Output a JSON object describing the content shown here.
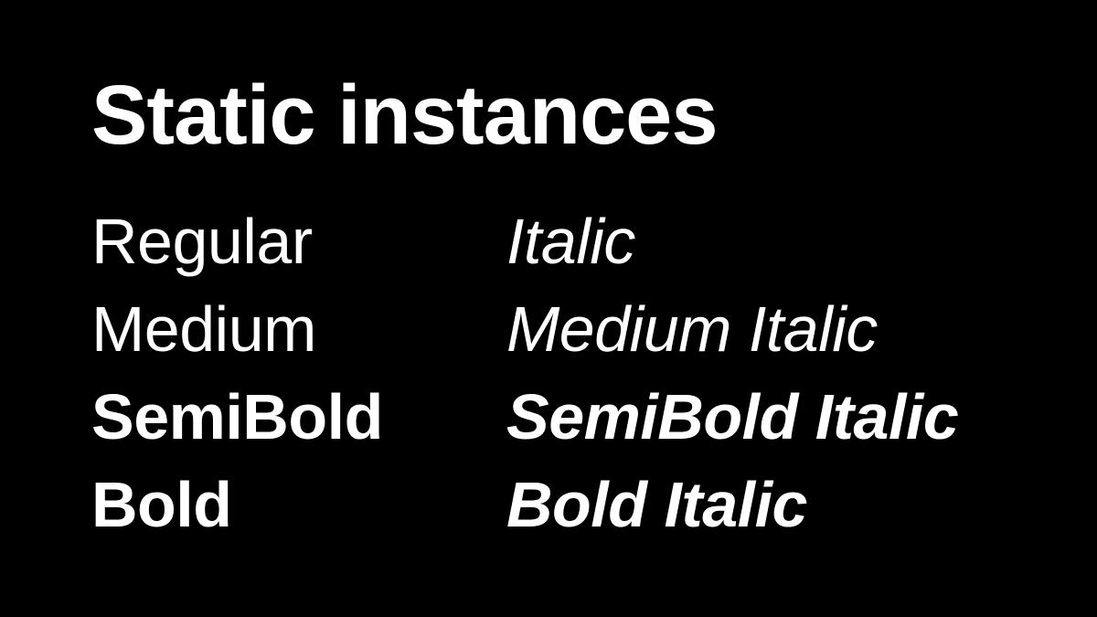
{
  "title": "Static instances",
  "rows": [
    {
      "upright": "Regular",
      "italic": "Italic"
    },
    {
      "upright": "Medium",
      "italic": "Medium Italic"
    },
    {
      "upright": "SemiBold",
      "italic": "SemiBold Italic"
    },
    {
      "upright": "Bold",
      "italic": "Bold Italic"
    }
  ],
  "colors": {
    "background": "#000000",
    "text": "#ffffff"
  }
}
